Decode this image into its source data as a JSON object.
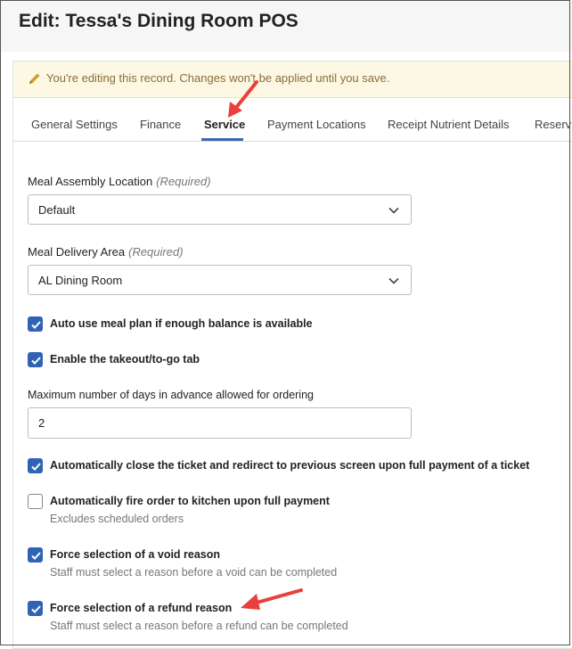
{
  "page": {
    "title": "Edit: Tessa's Dining Room POS"
  },
  "notice": {
    "icon": "pencil-icon",
    "text": "You're editing this record. Changes won't be applied until you save."
  },
  "tabs": [
    {
      "label": "General Settings",
      "active": false
    },
    {
      "label": "Finance",
      "active": false
    },
    {
      "label": "Service",
      "active": true
    },
    {
      "label": "Payment Locations",
      "active": false
    },
    {
      "label": "Receipt Nutrient Details",
      "active": false
    },
    {
      "label": "Reserv",
      "active": false
    }
  ],
  "form": {
    "meal_assembly": {
      "label": "Meal Assembly Location",
      "required": "(Required)",
      "value": "Default"
    },
    "meal_delivery": {
      "label": "Meal Delivery Area",
      "required": "(Required)",
      "value": "AL Dining Room"
    },
    "auto_meal_plan": {
      "label": "Auto use meal plan if enough balance is available",
      "checked": true
    },
    "takeout_tab": {
      "label": "Enable the takeout/to-go tab",
      "checked": true
    },
    "max_days": {
      "label": "Maximum number of days in advance allowed for ordering",
      "value": "2"
    },
    "auto_close": {
      "label": "Automatically close the ticket and redirect to previous screen upon full payment of a ticket",
      "checked": true
    },
    "auto_fire": {
      "label": "Automatically fire order to kitchen upon full payment",
      "help": "Excludes scheduled orders",
      "checked": false
    },
    "void_reason": {
      "label": "Force selection of a void reason",
      "help": "Staff must select a reason before a void can be completed",
      "checked": true
    },
    "refund_reason": {
      "label": "Force selection of a refund reason",
      "help": "Staff must select a reason before a refund can be completed",
      "checked": true
    }
  },
  "colors": {
    "accent": "#2f64b5",
    "annotation_arrow": "#e8403a",
    "notice_bg": "#fcf8e3",
    "notice_text": "#8a6d3b"
  }
}
